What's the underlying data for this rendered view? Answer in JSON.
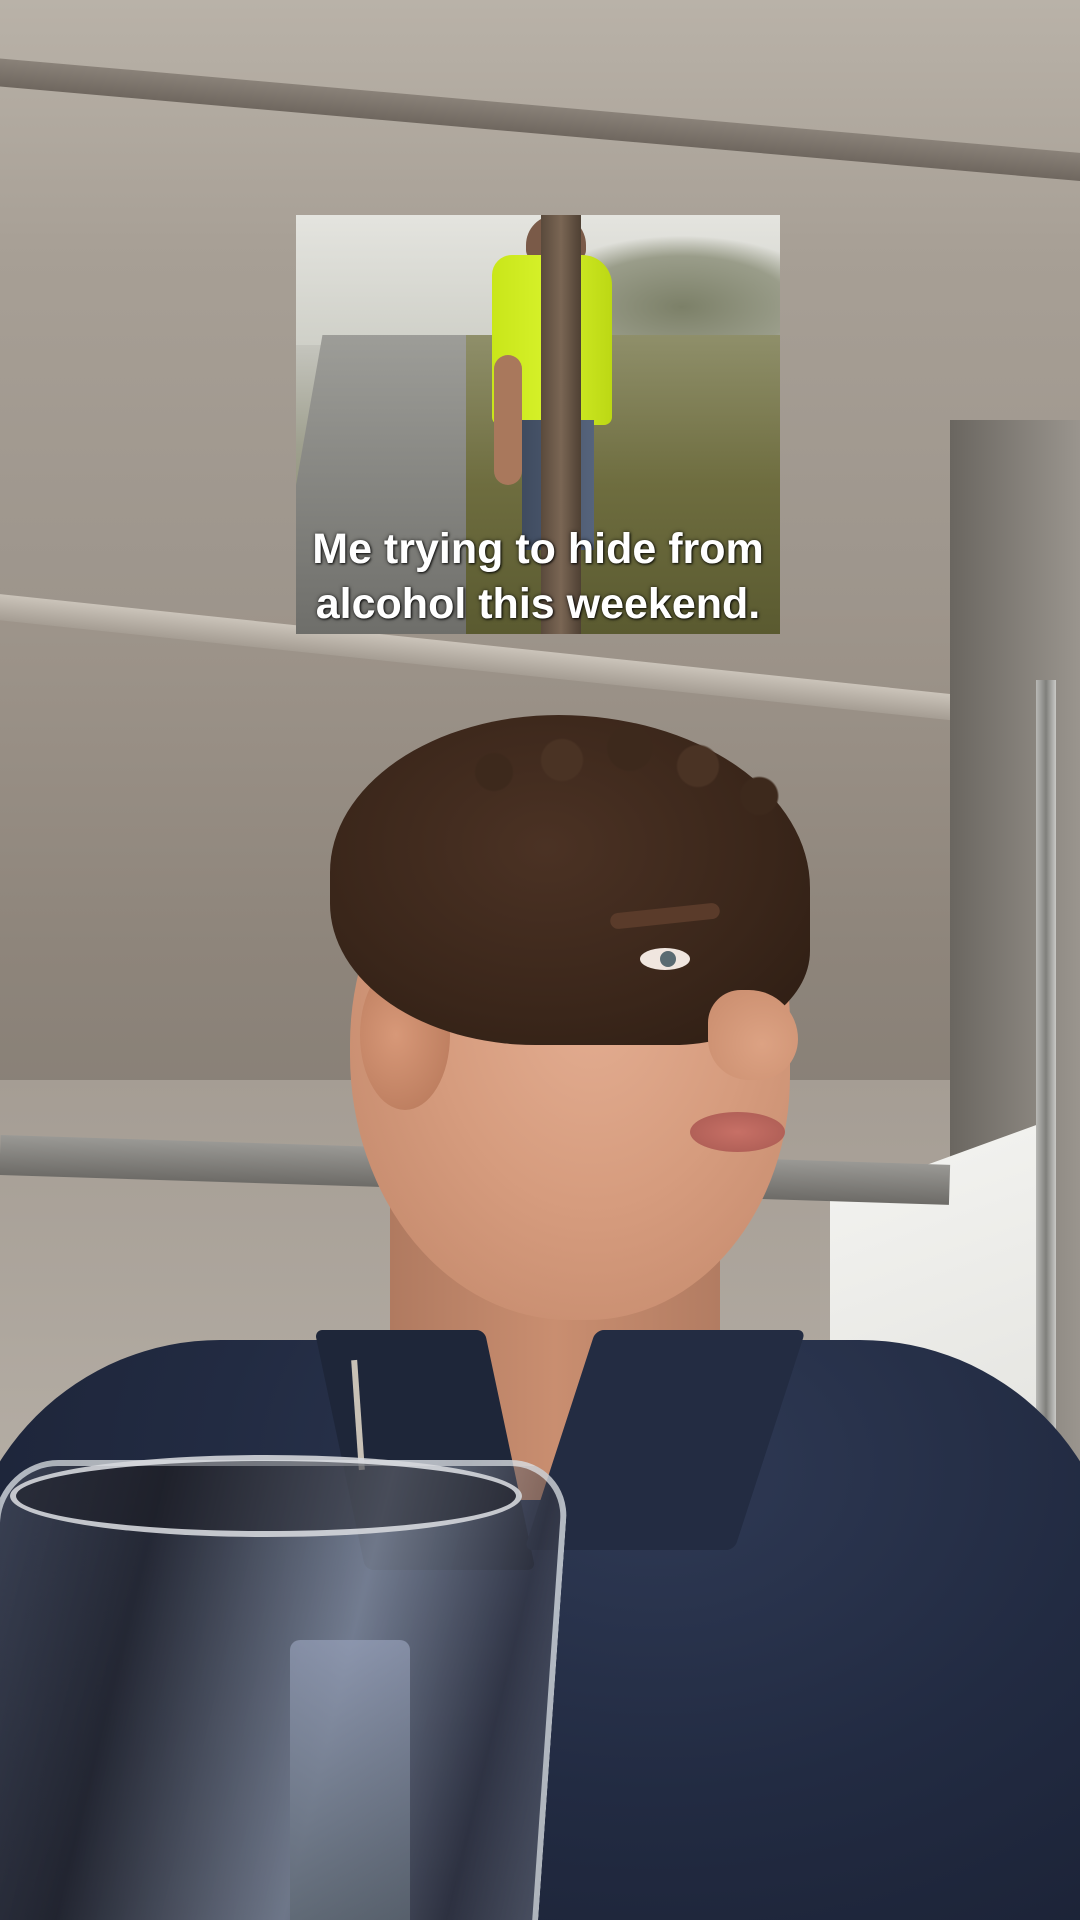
{
  "meme": {
    "caption_line1": "Me trying to hide from",
    "caption_line2": "alcohol this weekend."
  },
  "colors": {
    "caption_text": "#ffffff",
    "hi_vis_vest": "#d7f22b",
    "shirt": "#232c42"
  }
}
